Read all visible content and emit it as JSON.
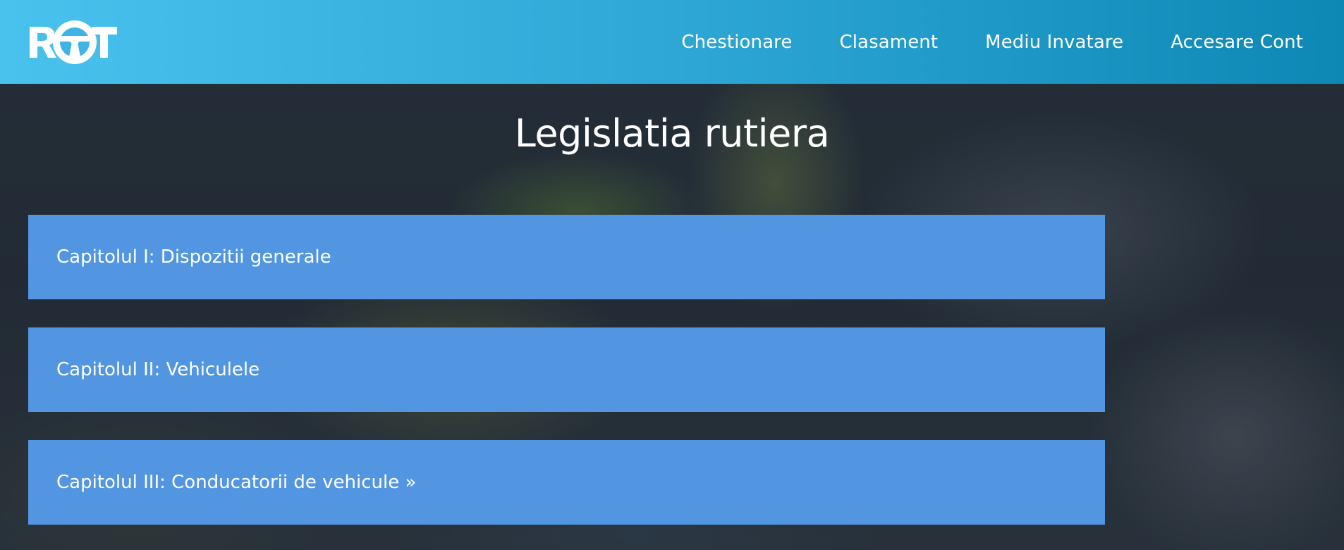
{
  "header": {
    "logo_text": "ROT",
    "nav": [
      {
        "label": "Chestionare"
      },
      {
        "label": "Clasament"
      },
      {
        "label": "Mediu Invatare"
      },
      {
        "label": "Accesare Cont"
      }
    ]
  },
  "main": {
    "title": "Legislatia rutiera",
    "chapters": [
      {
        "label": "Capitolul I: Dispozitii generale"
      },
      {
        "label": "Capitolul II: Vehiculele"
      },
      {
        "label": "Capitolul III: Conducatorii de vehicule »"
      }
    ]
  },
  "colors": {
    "header_gradient_start": "#49c2ee",
    "header_gradient_end": "#0d88b5",
    "chapter_bg": "#5296e2",
    "text": "#ffffff"
  },
  "icons": {
    "logo": "steering-wheel-icon"
  }
}
